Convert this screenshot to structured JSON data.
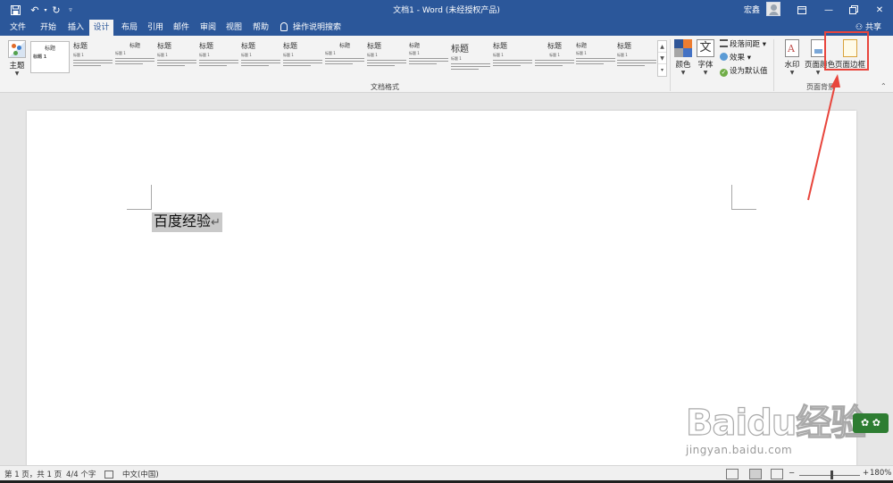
{
  "titlebar": {
    "doc_title": "文档1 - Word (未经授权产品)",
    "user_name": "宏鑫",
    "icons": [
      "save-icon",
      "undo-icon",
      "redo-icon",
      "customize-icon"
    ]
  },
  "tabs": [
    {
      "label": "文件",
      "active": false
    },
    {
      "label": "开始",
      "active": false
    },
    {
      "label": "插入",
      "active": false
    },
    {
      "label": "设计",
      "active": true
    },
    {
      "label": "布局",
      "active": false
    },
    {
      "label": "引用",
      "active": false
    },
    {
      "label": "邮件",
      "active": false
    },
    {
      "label": "审阅",
      "active": false
    },
    {
      "label": "视图",
      "active": false
    },
    {
      "label": "帮助",
      "active": false
    }
  ],
  "tell_me": "操作说明搜索",
  "share": "共享",
  "ribbon": {
    "theme_label": "主题",
    "doc_format_label": "文档格式",
    "styles": [
      {
        "head": "标题",
        "sub": "标题 1"
      },
      {
        "head": "标题",
        "sub": "标题 1"
      },
      {
        "head": "标题",
        "sub": "标题 1"
      },
      {
        "head": "标题",
        "sub": "标题 1"
      },
      {
        "head": "标题",
        "sub": "标题 1"
      },
      {
        "head": "标题",
        "sub": "标题 1"
      },
      {
        "head": "标题",
        "sub": "标题 1"
      },
      {
        "head": "标题",
        "sub": "标题 1"
      },
      {
        "head": "标题",
        "sub": "标题 1"
      },
      {
        "head": "标题",
        "sub": "标题 1"
      },
      {
        "head": "标题",
        "sub": "标题 1"
      },
      {
        "head": "标题",
        "sub": "标题 1"
      },
      {
        "head": "标题",
        "sub": "标题 1"
      },
      {
        "head": "标题",
        "sub": "标题 1"
      },
      {
        "head": "标题",
        "sub": "标题 1"
      }
    ],
    "colors_label": "颜色",
    "fonts_label": "字体",
    "paragraph_spacing_label": "段落间距",
    "effects_label": "效果",
    "set_default_label": "设为默认值",
    "watermark_label": "水印",
    "page_color_label": "页面颜色",
    "page_borders_label": "页面边框",
    "page_background_label": "页面背景"
  },
  "document": {
    "text": "百度经验",
    "pilcrow": "↵"
  },
  "watermark": {
    "brand": "Baidu经验",
    "url": "jingyan.baidu.com"
  },
  "statusbar": {
    "page": "第 1 页，共 1 页",
    "words": "4/4 个字",
    "language": "中文(中国)",
    "zoom": "180%"
  },
  "colors": {
    "title_bar": "#2b579a",
    "annotation_red": "#e8453c"
  }
}
